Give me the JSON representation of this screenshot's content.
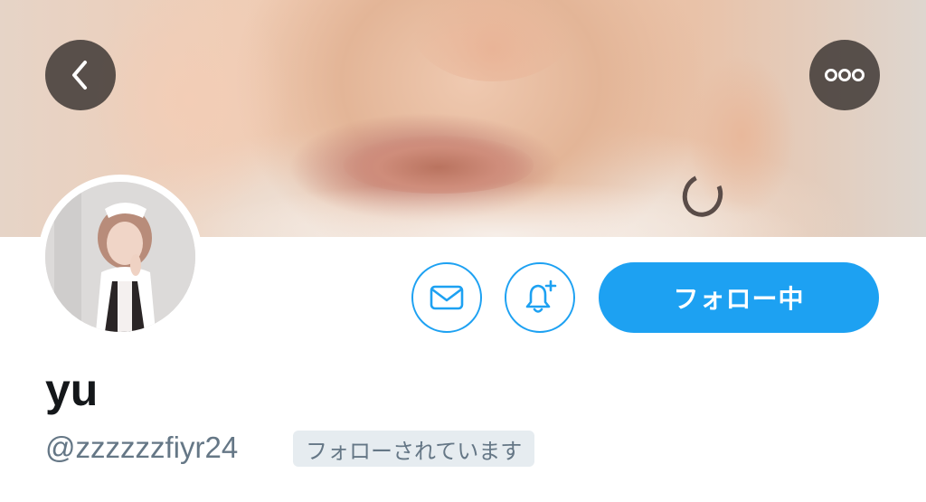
{
  "header": {
    "back_icon": "chevron-left-icon",
    "more_icon": "more-horizontal-icon"
  },
  "profile": {
    "display_name": "yu",
    "handle": "@zzzzzzfiyr24",
    "follows_you_badge": "フォローされています"
  },
  "actions": {
    "message_icon": "mail-icon",
    "notify_icon": "bell-plus-icon",
    "follow_label": "フォロー中"
  },
  "colors": {
    "accent": "#1da1f2",
    "text_primary": "#14171a",
    "text_secondary": "#657786",
    "badge_bg": "#e6ecf0"
  }
}
